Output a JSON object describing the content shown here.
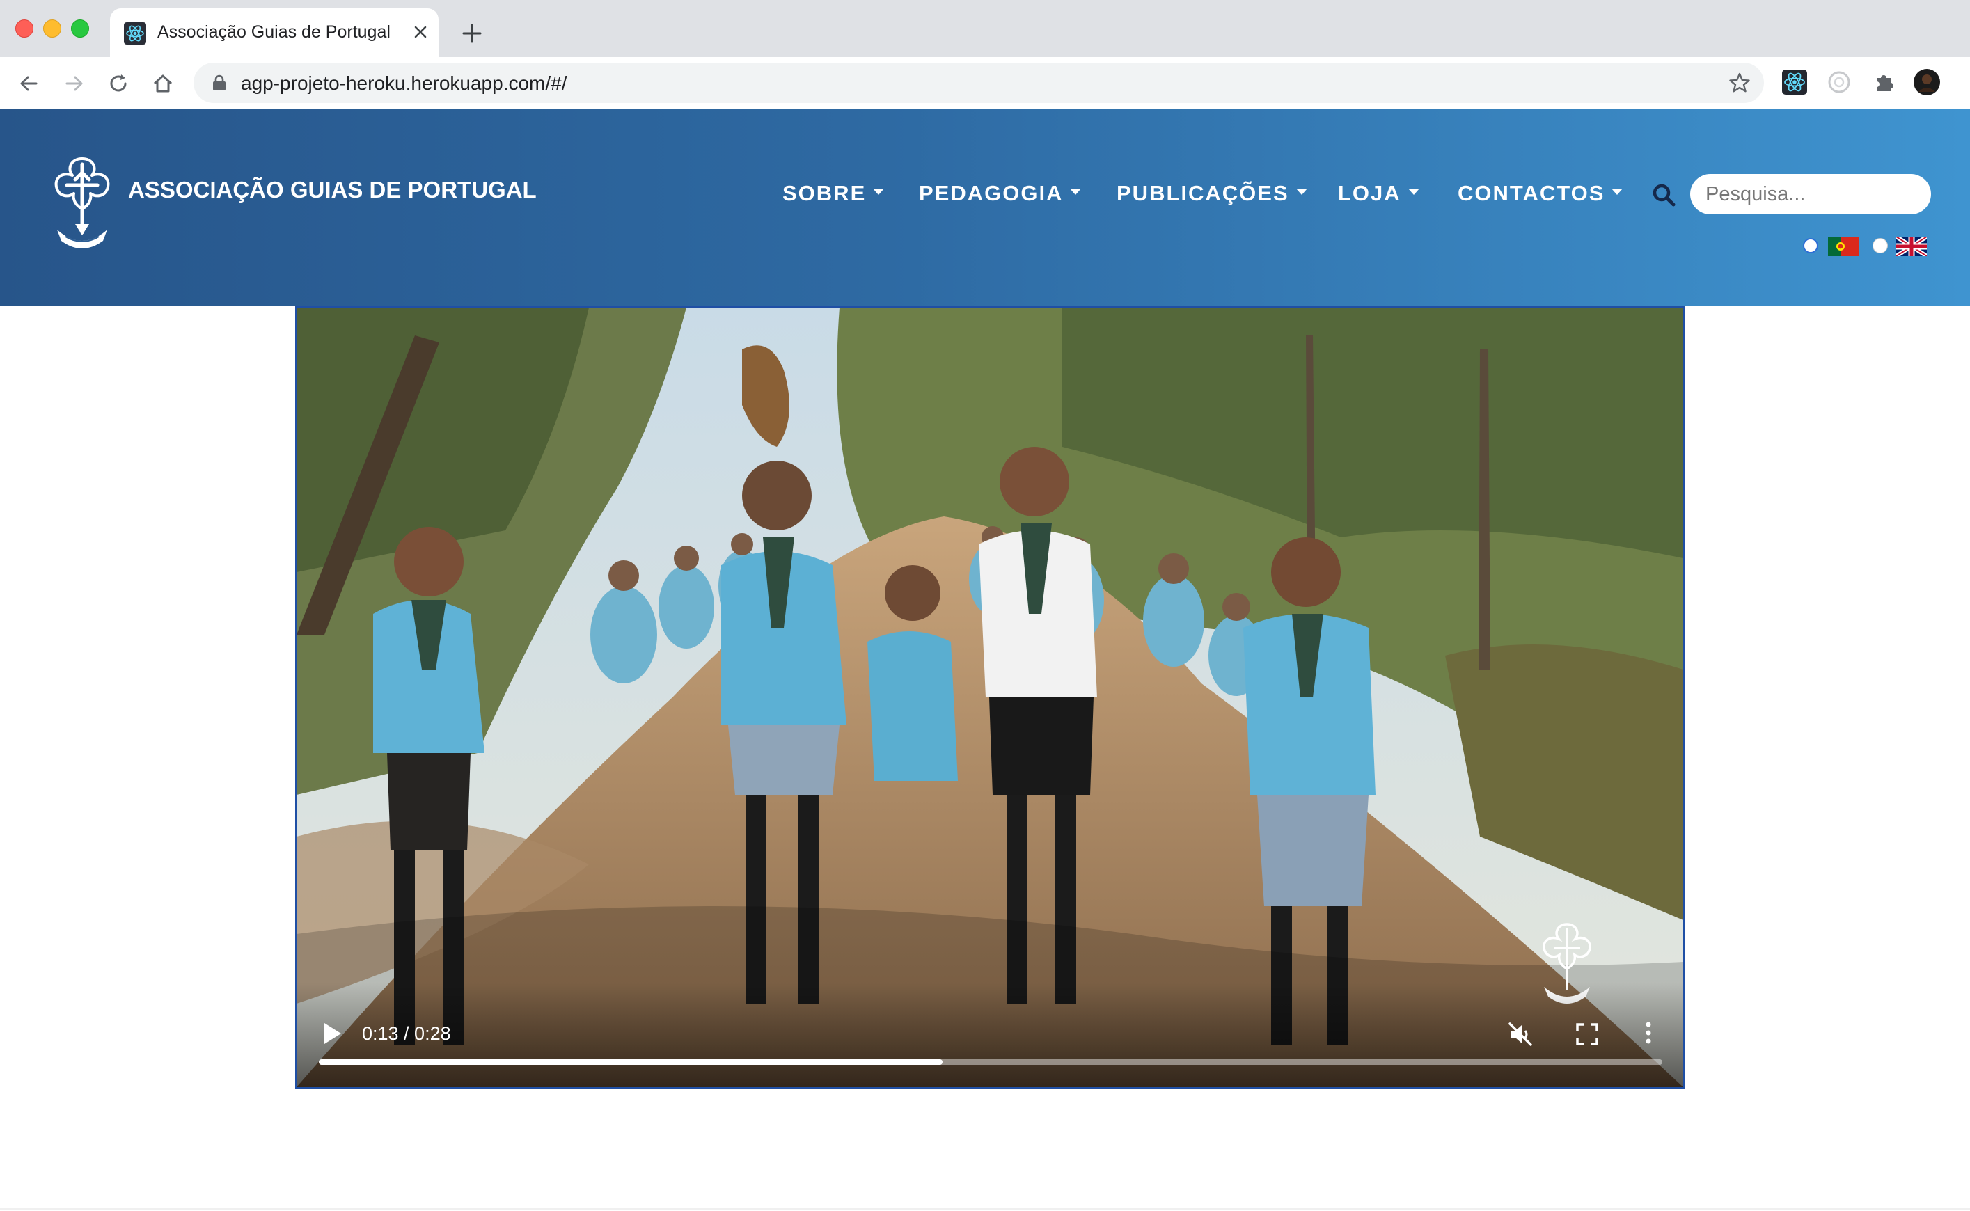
{
  "browser": {
    "tab_title": "Associação Guias de Portugal",
    "url": "agp-projeto-heroku.herokuapp.com/#/"
  },
  "site": {
    "name": "ASSOCIAÇÃO GUIAS DE PORTUGAL",
    "nav": [
      {
        "label": "SOBRE"
      },
      {
        "label": "PEDAGOGIA"
      },
      {
        "label": "PUBLICAÇÕES"
      },
      {
        "label": "LOJA"
      },
      {
        "label": "CONTACTOS"
      }
    ],
    "search": {
      "placeholder": "Pesquisa..."
    },
    "languages": [
      {
        "code": "pt",
        "selected": true
      },
      {
        "code": "en",
        "selected": false
      }
    ],
    "colors": {
      "header_start": "#27558a",
      "header_end": "#3f94d0",
      "video_border": "#1f4fa5"
    }
  },
  "video": {
    "time_display": "0:13 / 0:28",
    "current_seconds": 13,
    "duration_seconds": 28,
    "muted": true,
    "playing": false
  }
}
